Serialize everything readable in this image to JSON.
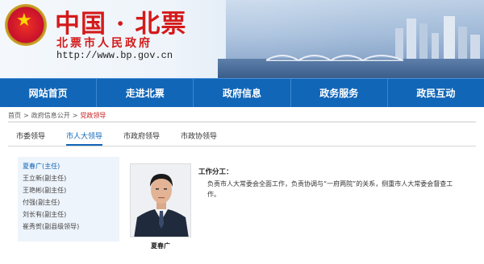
{
  "header": {
    "title": "中国 · 北票",
    "subtitle": "北票市人民政府",
    "url": "http://www.bp.gov.cn"
  },
  "nav": {
    "items": [
      {
        "label": "网站首页"
      },
      {
        "label": "走进北票"
      },
      {
        "label": "政府信息"
      },
      {
        "label": "政务服务"
      },
      {
        "label": "政民互动"
      }
    ]
  },
  "breadcrumb": {
    "items": [
      "首页",
      "政府信息公开",
      "党政领导"
    ],
    "separator": ">"
  },
  "tabs": [
    {
      "label": "市委领导",
      "active": false
    },
    {
      "label": "市人大领导",
      "active": true
    },
    {
      "label": "市政府领导",
      "active": false
    },
    {
      "label": "市政协领导",
      "active": false
    }
  ],
  "sidebar": {
    "items": [
      {
        "label": "夏春广(主任)",
        "active": true
      },
      {
        "label": "王立新(副主任)",
        "active": false
      },
      {
        "label": "王艳彬(副主任)",
        "active": false
      },
      {
        "label": "付强(副主任)",
        "active": false
      },
      {
        "label": "刘长有(副主任)",
        "active": false
      },
      {
        "label": "崔秀贺(副县级领导)",
        "active": false
      }
    ]
  },
  "profile": {
    "name": "夏春广",
    "duty_title": "工作分工：",
    "duty_text": "负责市人大常委会全面工作，负责协调与“一府两院”的关系，侧重市人大常委会督查工作。"
  },
  "colors": {
    "nav_bg": "#1166b8",
    "title_red": "#d41a1a",
    "active_blue": "#1166b8",
    "breadcrumb_current": "#c81a1a"
  }
}
